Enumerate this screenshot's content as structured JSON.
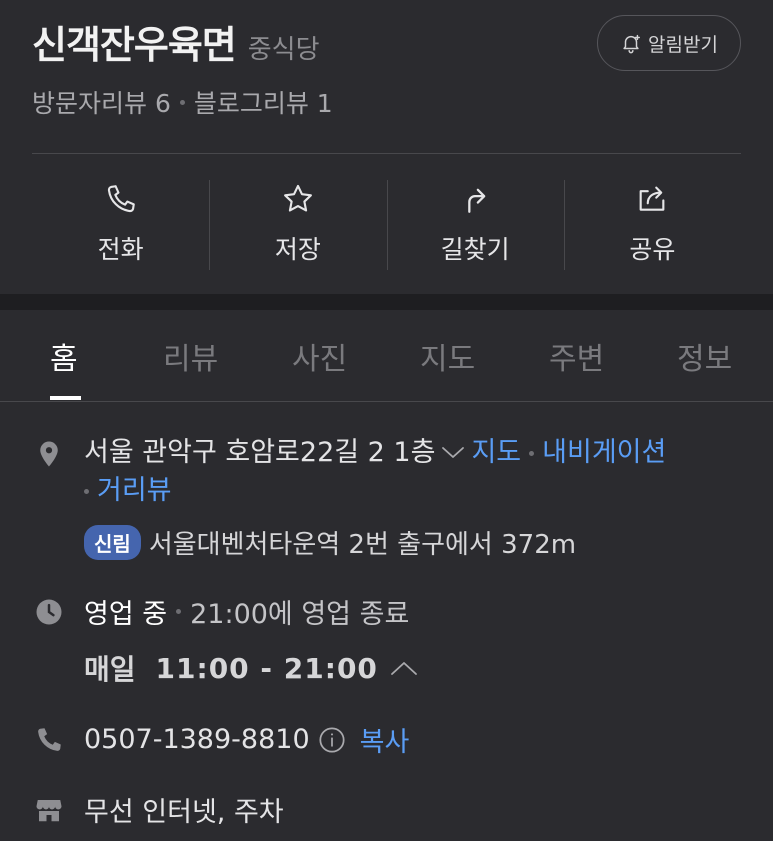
{
  "header": {
    "title": "신객잔우육면",
    "category": "중식당",
    "notify_label": "알림받기",
    "visitor_reviews": "방문자리뷰 6",
    "blog_reviews": "블로그리뷰 1"
  },
  "actions": {
    "call": "전화",
    "save": "저장",
    "directions": "길찾기",
    "share": "공유"
  },
  "tabs": {
    "home": "홈",
    "reviews": "리뷰",
    "photos": "사진",
    "map": "지도",
    "nearby": "주변",
    "info": "정보"
  },
  "info": {
    "address": "서울 관악구 호암로22길 2 1층",
    "map_link": "지도",
    "navigation_link": "내비게이션",
    "streetview_link": "거리뷰",
    "station_badge": "신림",
    "station_text": "서울대벤처타운역 2번 출구에서 372m",
    "hours_status": "영업 중",
    "hours_close": "21:00에 영업 종료",
    "daily_label": "매일",
    "daily_time": "11:00 - 21:00",
    "phone": "0507-1389-8810",
    "copy_label": "복사",
    "facilities": "무선 인터넷, 주차"
  },
  "colors": {
    "background": "#2b2b2f",
    "link": "#5a9df5",
    "badge": "#4565ae"
  }
}
